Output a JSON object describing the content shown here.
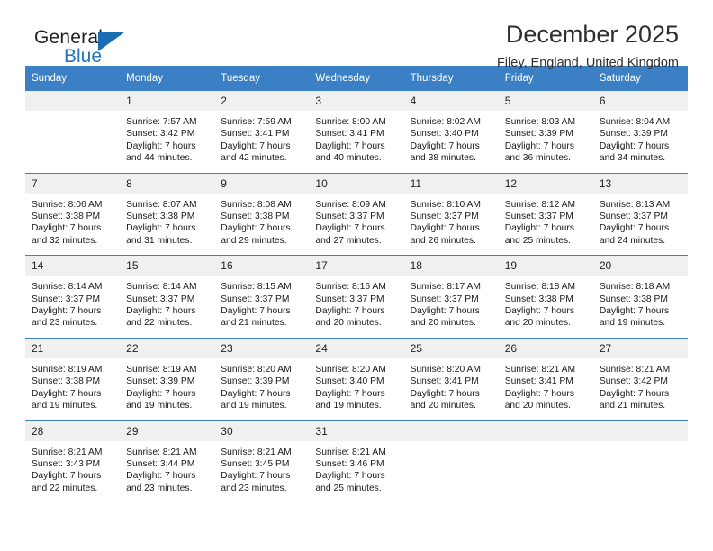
{
  "brand": {
    "name_part1": "General",
    "name_part2": "Blue",
    "triangle_color": "#1b6cb3",
    "blue_color": "#2275bb"
  },
  "header": {
    "title": "December 2025",
    "subtitle": "Filey, England, United Kingdom"
  },
  "calendar": {
    "accent_color": "#3b7fc4",
    "daynum_bg": "#f0f0f0",
    "weekday_headers": [
      "Sunday",
      "Monday",
      "Tuesday",
      "Wednesday",
      "Thursday",
      "Friday",
      "Saturday"
    ],
    "labels": {
      "sunrise_prefix": "Sunrise:",
      "sunset_prefix": "Sunset:",
      "daylight_prefix": "Daylight:"
    },
    "weeks": [
      [
        {
          "day": "",
          "sunrise": "",
          "sunset": "",
          "daylight_line1": "",
          "daylight_line2": ""
        },
        {
          "day": "1",
          "sunrise": "Sunrise: 7:57 AM",
          "sunset": "Sunset: 3:42 PM",
          "daylight_line1": "Daylight: 7 hours",
          "daylight_line2": "and 44 minutes."
        },
        {
          "day": "2",
          "sunrise": "Sunrise: 7:59 AM",
          "sunset": "Sunset: 3:41 PM",
          "daylight_line1": "Daylight: 7 hours",
          "daylight_line2": "and 42 minutes."
        },
        {
          "day": "3",
          "sunrise": "Sunrise: 8:00 AM",
          "sunset": "Sunset: 3:41 PM",
          "daylight_line1": "Daylight: 7 hours",
          "daylight_line2": "and 40 minutes."
        },
        {
          "day": "4",
          "sunrise": "Sunrise: 8:02 AM",
          "sunset": "Sunset: 3:40 PM",
          "daylight_line1": "Daylight: 7 hours",
          "daylight_line2": "and 38 minutes."
        },
        {
          "day": "5",
          "sunrise": "Sunrise: 8:03 AM",
          "sunset": "Sunset: 3:39 PM",
          "daylight_line1": "Daylight: 7 hours",
          "daylight_line2": "and 36 minutes."
        },
        {
          "day": "6",
          "sunrise": "Sunrise: 8:04 AM",
          "sunset": "Sunset: 3:39 PM",
          "daylight_line1": "Daylight: 7 hours",
          "daylight_line2": "and 34 minutes."
        }
      ],
      [
        {
          "day": "7",
          "sunrise": "Sunrise: 8:06 AM",
          "sunset": "Sunset: 3:38 PM",
          "daylight_line1": "Daylight: 7 hours",
          "daylight_line2": "and 32 minutes."
        },
        {
          "day": "8",
          "sunrise": "Sunrise: 8:07 AM",
          "sunset": "Sunset: 3:38 PM",
          "daylight_line1": "Daylight: 7 hours",
          "daylight_line2": "and 31 minutes."
        },
        {
          "day": "9",
          "sunrise": "Sunrise: 8:08 AM",
          "sunset": "Sunset: 3:38 PM",
          "daylight_line1": "Daylight: 7 hours",
          "daylight_line2": "and 29 minutes."
        },
        {
          "day": "10",
          "sunrise": "Sunrise: 8:09 AM",
          "sunset": "Sunset: 3:37 PM",
          "daylight_line1": "Daylight: 7 hours",
          "daylight_line2": "and 27 minutes."
        },
        {
          "day": "11",
          "sunrise": "Sunrise: 8:10 AM",
          "sunset": "Sunset: 3:37 PM",
          "daylight_line1": "Daylight: 7 hours",
          "daylight_line2": "and 26 minutes."
        },
        {
          "day": "12",
          "sunrise": "Sunrise: 8:12 AM",
          "sunset": "Sunset: 3:37 PM",
          "daylight_line1": "Daylight: 7 hours",
          "daylight_line2": "and 25 minutes."
        },
        {
          "day": "13",
          "sunrise": "Sunrise: 8:13 AM",
          "sunset": "Sunset: 3:37 PM",
          "daylight_line1": "Daylight: 7 hours",
          "daylight_line2": "and 24 minutes."
        }
      ],
      [
        {
          "day": "14",
          "sunrise": "Sunrise: 8:14 AM",
          "sunset": "Sunset: 3:37 PM",
          "daylight_line1": "Daylight: 7 hours",
          "daylight_line2": "and 23 minutes."
        },
        {
          "day": "15",
          "sunrise": "Sunrise: 8:14 AM",
          "sunset": "Sunset: 3:37 PM",
          "daylight_line1": "Daylight: 7 hours",
          "daylight_line2": "and 22 minutes."
        },
        {
          "day": "16",
          "sunrise": "Sunrise: 8:15 AM",
          "sunset": "Sunset: 3:37 PM",
          "daylight_line1": "Daylight: 7 hours",
          "daylight_line2": "and 21 minutes."
        },
        {
          "day": "17",
          "sunrise": "Sunrise: 8:16 AM",
          "sunset": "Sunset: 3:37 PM",
          "daylight_line1": "Daylight: 7 hours",
          "daylight_line2": "and 20 minutes."
        },
        {
          "day": "18",
          "sunrise": "Sunrise: 8:17 AM",
          "sunset": "Sunset: 3:37 PM",
          "daylight_line1": "Daylight: 7 hours",
          "daylight_line2": "and 20 minutes."
        },
        {
          "day": "19",
          "sunrise": "Sunrise: 8:18 AM",
          "sunset": "Sunset: 3:38 PM",
          "daylight_line1": "Daylight: 7 hours",
          "daylight_line2": "and 20 minutes."
        },
        {
          "day": "20",
          "sunrise": "Sunrise: 8:18 AM",
          "sunset": "Sunset: 3:38 PM",
          "daylight_line1": "Daylight: 7 hours",
          "daylight_line2": "and 19 minutes."
        }
      ],
      [
        {
          "day": "21",
          "sunrise": "Sunrise: 8:19 AM",
          "sunset": "Sunset: 3:38 PM",
          "daylight_line1": "Daylight: 7 hours",
          "daylight_line2": "and 19 minutes."
        },
        {
          "day": "22",
          "sunrise": "Sunrise: 8:19 AM",
          "sunset": "Sunset: 3:39 PM",
          "daylight_line1": "Daylight: 7 hours",
          "daylight_line2": "and 19 minutes."
        },
        {
          "day": "23",
          "sunrise": "Sunrise: 8:20 AM",
          "sunset": "Sunset: 3:39 PM",
          "daylight_line1": "Daylight: 7 hours",
          "daylight_line2": "and 19 minutes."
        },
        {
          "day": "24",
          "sunrise": "Sunrise: 8:20 AM",
          "sunset": "Sunset: 3:40 PM",
          "daylight_line1": "Daylight: 7 hours",
          "daylight_line2": "and 19 minutes."
        },
        {
          "day": "25",
          "sunrise": "Sunrise: 8:20 AM",
          "sunset": "Sunset: 3:41 PM",
          "daylight_line1": "Daylight: 7 hours",
          "daylight_line2": "and 20 minutes."
        },
        {
          "day": "26",
          "sunrise": "Sunrise: 8:21 AM",
          "sunset": "Sunset: 3:41 PM",
          "daylight_line1": "Daylight: 7 hours",
          "daylight_line2": "and 20 minutes."
        },
        {
          "day": "27",
          "sunrise": "Sunrise: 8:21 AM",
          "sunset": "Sunset: 3:42 PM",
          "daylight_line1": "Daylight: 7 hours",
          "daylight_line2": "and 21 minutes."
        }
      ],
      [
        {
          "day": "28",
          "sunrise": "Sunrise: 8:21 AM",
          "sunset": "Sunset: 3:43 PM",
          "daylight_line1": "Daylight: 7 hours",
          "daylight_line2": "and 22 minutes."
        },
        {
          "day": "29",
          "sunrise": "Sunrise: 8:21 AM",
          "sunset": "Sunset: 3:44 PM",
          "daylight_line1": "Daylight: 7 hours",
          "daylight_line2": "and 23 minutes."
        },
        {
          "day": "30",
          "sunrise": "Sunrise: 8:21 AM",
          "sunset": "Sunset: 3:45 PM",
          "daylight_line1": "Daylight: 7 hours",
          "daylight_line2": "and 23 minutes."
        },
        {
          "day": "31",
          "sunrise": "Sunrise: 8:21 AM",
          "sunset": "Sunset: 3:46 PM",
          "daylight_line1": "Daylight: 7 hours",
          "daylight_line2": "and 25 minutes."
        },
        {
          "day": "",
          "sunrise": "",
          "sunset": "",
          "daylight_line1": "",
          "daylight_line2": ""
        },
        {
          "day": "",
          "sunrise": "",
          "sunset": "",
          "daylight_line1": "",
          "daylight_line2": ""
        },
        {
          "day": "",
          "sunrise": "",
          "sunset": "",
          "daylight_line1": "",
          "daylight_line2": ""
        }
      ]
    ]
  }
}
